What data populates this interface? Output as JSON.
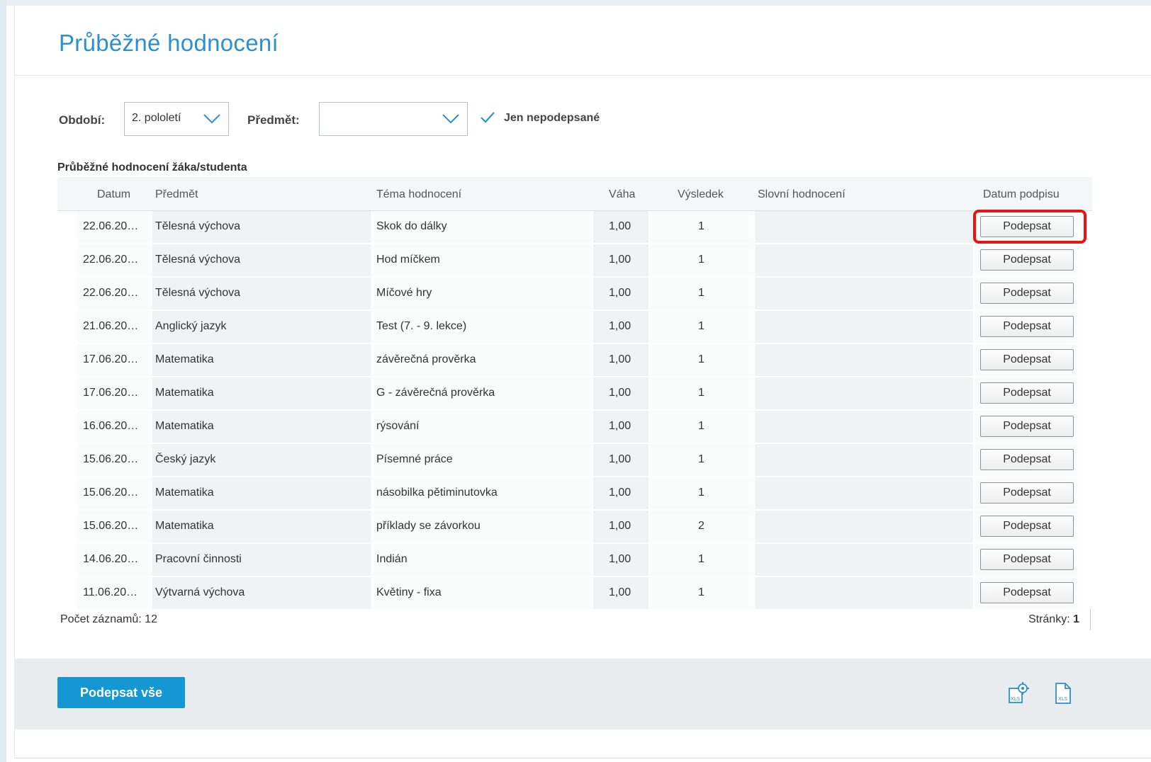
{
  "page": {
    "title": "Průběžné hodnocení"
  },
  "filters": {
    "period_label": "Období:",
    "period_value": "2. pololetí",
    "subject_label": "Předmět:",
    "subject_value": "",
    "unsigned_only_label": "Jen nepodepsané"
  },
  "grid": {
    "caption": "Průběžné hodnocení žáka/studenta",
    "columns": [
      "Datum",
      "Předmět",
      "Téma hodnocení",
      "Váha",
      "Výsledek",
      "Slovní hodnocení",
      "Datum podpisu"
    ],
    "rows": [
      {
        "date": "22.06.20…",
        "subject": "Tělesná výchova",
        "topic": "Skok do dálky",
        "weight": "1,00",
        "result": "1",
        "verbal": "",
        "sign": "Podepsat"
      },
      {
        "date": "22.06.20…",
        "subject": "Tělesná výchova",
        "topic": "Hod míčkem",
        "weight": "1,00",
        "result": "1",
        "verbal": "",
        "sign": "Podepsat"
      },
      {
        "date": "22.06.20…",
        "subject": "Tělesná výchova",
        "topic": "Míčové hry",
        "weight": "1,00",
        "result": "1",
        "verbal": "",
        "sign": "Podepsat"
      },
      {
        "date": "21.06.20…",
        "subject": "Anglický jazyk",
        "topic": "Test (7. - 9. lekce)",
        "weight": "1,00",
        "result": "1",
        "verbal": "",
        "sign": "Podepsat"
      },
      {
        "date": "17.06.20…",
        "subject": "Matematika",
        "topic": "závěrečná prověrka",
        "weight": "1,00",
        "result": "1",
        "verbal": "",
        "sign": "Podepsat"
      },
      {
        "date": "17.06.20…",
        "subject": "Matematika",
        "topic": "G - závěrečná prověrka",
        "weight": "1,00",
        "result": "1",
        "verbal": "",
        "sign": "Podepsat"
      },
      {
        "date": "16.06.20…",
        "subject": "Matematika",
        "topic": "rýsování",
        "weight": "1,00",
        "result": "1",
        "verbal": "",
        "sign": "Podepsat"
      },
      {
        "date": "15.06.20…",
        "subject": "Český jazyk",
        "topic": "Písemné práce",
        "weight": "1,00",
        "result": "1",
        "verbal": "",
        "sign": "Podepsat"
      },
      {
        "date": "15.06.20…",
        "subject": "Matematika",
        "topic": "násobilka pětiminutovka",
        "weight": "1,00",
        "result": "1",
        "verbal": "",
        "sign": "Podepsat"
      },
      {
        "date": "15.06.20…",
        "subject": "Matematika",
        "topic": "příklady se závorkou",
        "weight": "1,00",
        "result": "2",
        "verbal": "",
        "sign": "Podepsat"
      },
      {
        "date": "14.06.20…",
        "subject": "Pracovní činnosti",
        "topic": "Indián",
        "weight": "1,00",
        "result": "1",
        "verbal": "",
        "sign": "Podepsat"
      },
      {
        "date": "11.06.20…",
        "subject": "Výtvarná výchova",
        "topic": "Květiny - fixa",
        "weight": "1,00",
        "result": "1",
        "verbal": "",
        "sign": "Podepsat"
      }
    ],
    "record_count": "Počet záznamů: 12",
    "pages_label": "Stránky:",
    "pages_value": "1"
  },
  "footer": {
    "sign_all_label": "Podepsat vše",
    "icons": [
      "xls-settings-icon",
      "xls-export-icon"
    ]
  },
  "colors": {
    "accent": "#1597d4",
    "title": "#2c8fd0",
    "highlight": "#e81414"
  }
}
